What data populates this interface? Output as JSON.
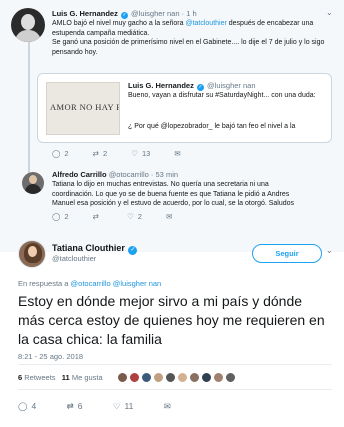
{
  "tweet1": {
    "name": "Luis G. Hernandez",
    "handle": "@luisgher nan",
    "dot": "·",
    "time": "1 h",
    "text_parts": {
      "pre": "AMLO bajó el nivel muy gacho a la señora ",
      "mention": "@tatclouthier",
      "post": " después de encabezar una estupenda campaña mediática.",
      "line2": "Se ganó una posición de primerísimo nivel en el Gabinete.... lo dije el 7 de julio y lo sigo pensando hoy."
    },
    "replies": "2",
    "retweets": "2",
    "likes": "13"
  },
  "quote": {
    "name": "Luis G. Hernandez",
    "handle": "@luisgher nan",
    "text": "Bueno, vayan a disfrutar su #SaturdayNight... con una duda:",
    "text2": "¿ Por qué @lopezobrador_ le bajó tan feo el nivel a la",
    "image_text": "AMOR NO HAY F"
  },
  "tweet2": {
    "name": "Alfredo Carrillo",
    "handle": "@otocarrillo",
    "dot": "·",
    "time": "53 min",
    "line1": "Tatiana lo dijo en muchas entrevistas. No quería una secretaria ni una",
    "line2": "coordinación. Lo que yo se de buena fuente es que Tatiana le pidió a Andres",
    "line3": "Manuel esa posición y el estuvo de acuerdo, por lo cual, se la otorgó. Saludos",
    "replies": "2",
    "retweets": "",
    "likes": "2"
  },
  "main": {
    "name": "Tatiana Clouthier",
    "handle": "@tatclouthier",
    "follow_label": "Seguir",
    "reply_prefix": "En respuesta a",
    "reply_mentions": "@otocarrillo @luisgher nan",
    "text": "Estoy en dónde mejor sirvo a mi país y dónde más cerca estoy de quienes hoy me requieren en la casa chica: la familia",
    "datetime": "8:21 - 25 ago. 2018",
    "retweets_count": "6",
    "retweets_label": "Retweets",
    "likes_count": "11",
    "likes_label": "Me gusta",
    "liker_colors": [
      "#7a5a4a",
      "#b04040",
      "#3b5b7b",
      "#c0a080",
      "#555555",
      "#d4b090",
      "#8a7060",
      "#304050",
      "#a08070",
      "#606060"
    ],
    "replies": "4",
    "retweets": "6",
    "likes": "11"
  },
  "colors": {
    "accent": "#1da1f2",
    "mention": "#1b95e0",
    "muted": "#657786"
  }
}
